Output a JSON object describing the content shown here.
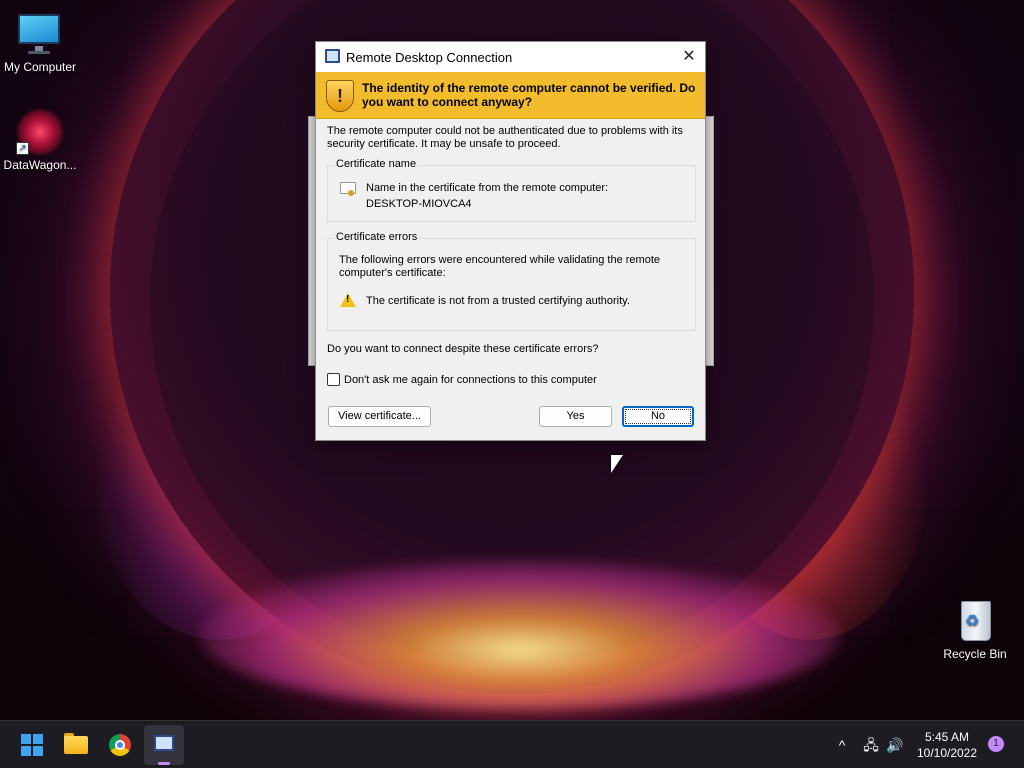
{
  "desktop": {
    "icons": [
      {
        "label": "My Computer",
        "icon": "monitor-icon"
      },
      {
        "label": "DataWagon...",
        "icon": "datawagon-shortcut-icon"
      },
      {
        "label": "Recycle Bin",
        "icon": "recycle-bin-icon"
      }
    ]
  },
  "dialog": {
    "title": "Remote Desktop Connection",
    "close_glyph": "✕",
    "banner": "The identity of the remote computer cannot be verified. Do you want to connect anyway?",
    "intro": "The remote computer could not be authenticated due to problems with its security certificate. It may be unsafe to proceed.",
    "cert_group": {
      "legend": "Certificate name",
      "line1": "Name in the certificate from the remote computer:",
      "line2": "DESKTOP-MIOVCA4"
    },
    "error_group": {
      "legend": "Certificate errors",
      "description": "The following errors were encountered while validating the remote computer's certificate:",
      "error": "The certificate is not from a trusted certifying authority."
    },
    "question": "Do you want to connect despite these certificate errors?",
    "checkbox_label": "Don't ask me again for connections to this computer",
    "checkbox_checked": false,
    "buttons": {
      "view": "View certificate...",
      "yes": "Yes",
      "no": "No"
    },
    "banner_color": "#f3bc2d"
  },
  "taskbar": {
    "apps": [
      "start-icon",
      "file-explorer-icon",
      "chrome-icon",
      "remote-desktop-icon"
    ],
    "active_app": "Remote Desktop Connection",
    "tray": {
      "chevron": "^",
      "network": "🖧",
      "volume": "🔊"
    },
    "time": "5:45 AM",
    "date": "10/10/2022",
    "notification_count": "1"
  }
}
